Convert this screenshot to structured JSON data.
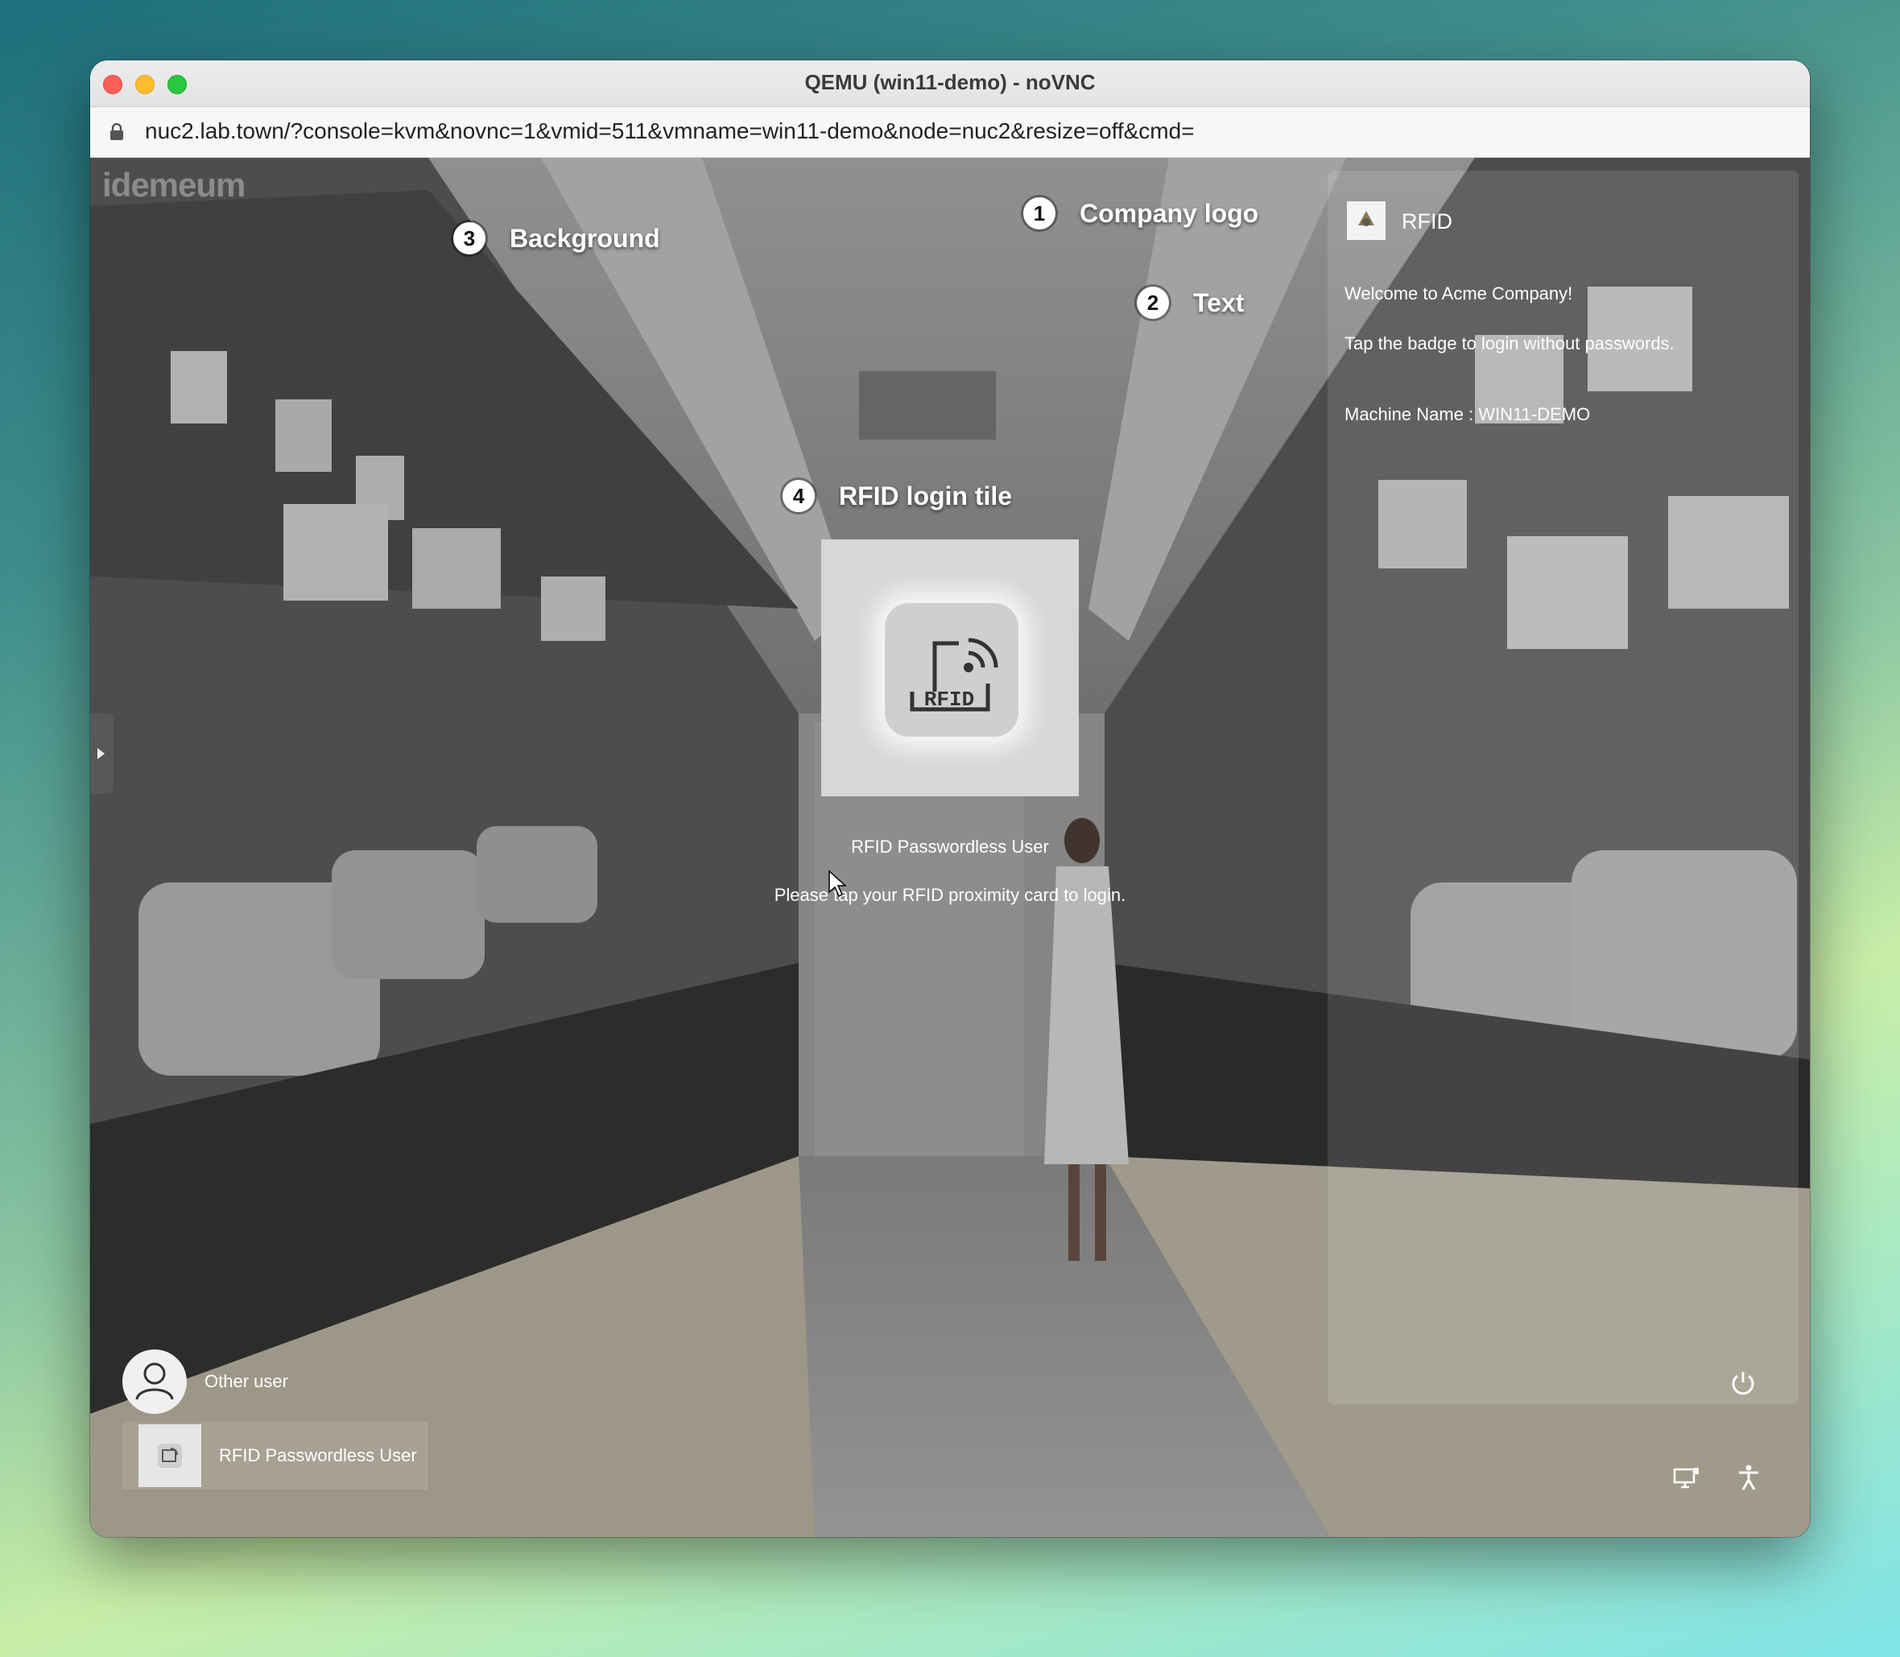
{
  "window": {
    "title": "QEMU (win11-demo) - noVNC",
    "url": "nuc2.lab.town/?console=kvm&novnc=1&vmid=511&vmname=win11-demo&node=nuc2&resize=off&cmd="
  },
  "watermark": "idemeum",
  "callouts": [
    {
      "number": "1",
      "label": "Company logo"
    },
    {
      "number": "2",
      "label": "Text"
    },
    {
      "number": "3",
      "label": "Background"
    },
    {
      "number": "4",
      "label": "RFID login tile"
    }
  ],
  "panel": {
    "logo_title": "RFID",
    "welcome": "Welcome to Acme Company!",
    "instruction": "Tap the badge to login without passwords.",
    "machine": "Machine Name : WIN11-DEMO"
  },
  "tile": {
    "icon_text": "RFID",
    "user_name": "RFID Passwordless User",
    "prompt": "Please tap your RFID proximity card to login."
  },
  "users": [
    {
      "label": "Other user",
      "icon": "user-icon"
    },
    {
      "label": "RFID Passwordless User",
      "icon": "rfid-icon"
    }
  ],
  "system_icons": [
    "power-icon",
    "network-icon",
    "accessibility-icon"
  ]
}
